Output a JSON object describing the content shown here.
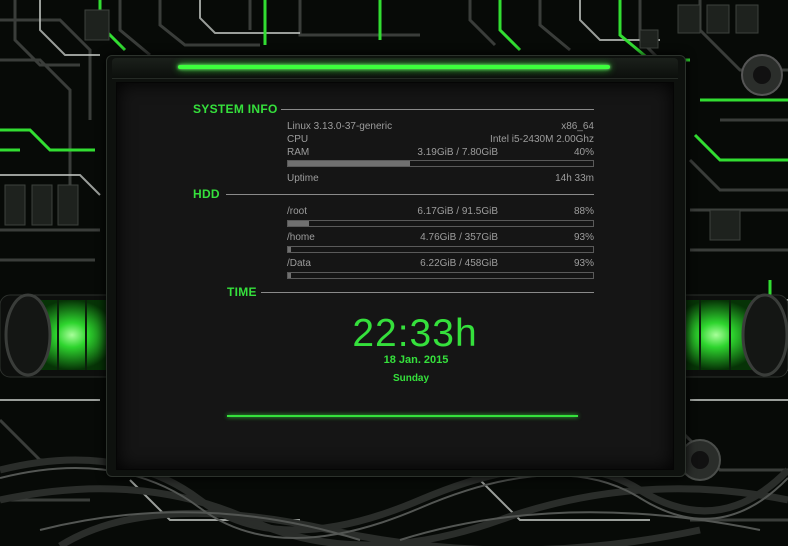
{
  "wallpaper": {
    "accent": "#35e03c",
    "glow": "#3dff3d",
    "base": "#070a07"
  },
  "conky": {
    "system_info": {
      "title": "SYSTEM INFO",
      "kernel": "Linux 3.13.0-37-generic",
      "arch": "x86_64",
      "cpu_label": "CPU",
      "cpu_value": "Intel i5-2430M 2.00Ghz",
      "ram_label": "RAM",
      "ram_usage": "3.19GiB / 7.80GiB",
      "ram_percent": "40%",
      "ram_fraction": 0.4,
      "uptime_label": "Uptime",
      "uptime_value": "14h 33m"
    },
    "hdd": {
      "title": "HDD",
      "drives": [
        {
          "mount": "/root",
          "usage": "6.17GiB / 91.5GiB",
          "percent": "88%",
          "free_fraction": 0.07
        },
        {
          "mount": "/home",
          "usage": "4.76GiB / 357GiB",
          "percent": "93%",
          "free_fraction": 0.01
        },
        {
          "mount": "/Data",
          "usage": "6.22GiB / 458GiB",
          "percent": "93%",
          "free_fraction": 0.01
        }
      ]
    },
    "time": {
      "title": "TIME",
      "clock": "22:33h",
      "date": "18 Jan. 2015",
      "day": "Sunday"
    }
  }
}
